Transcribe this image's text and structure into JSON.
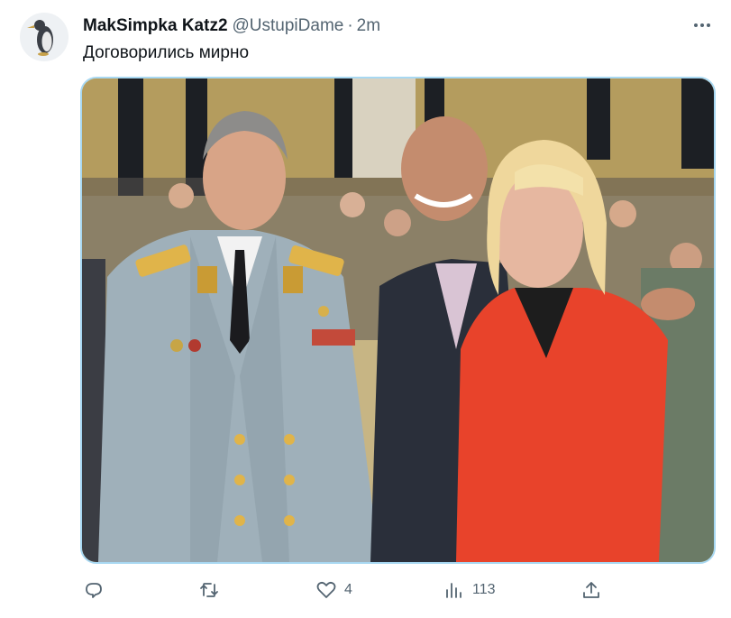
{
  "tweet": {
    "display_name": "MakSimpka Katz2",
    "handle": "@UstupiDame",
    "separator": "·",
    "time": "2m",
    "text": "Договорились мирно",
    "avatar_icon": "penguin-icon",
    "media_icon": "photo"
  },
  "actions": {
    "reply_icon": "reply-icon",
    "retweet_icon": "retweet-icon",
    "like_icon": "heart-icon",
    "like_count": "4",
    "views_icon": "views-icon",
    "views_count": "113",
    "share_icon": "share-icon"
  },
  "colors": {
    "text": "#0f1419",
    "secondary": "#536471",
    "media_border": "#a8d8f2",
    "uniform": "#9fb0ba",
    "dress": "#e8432b"
  }
}
